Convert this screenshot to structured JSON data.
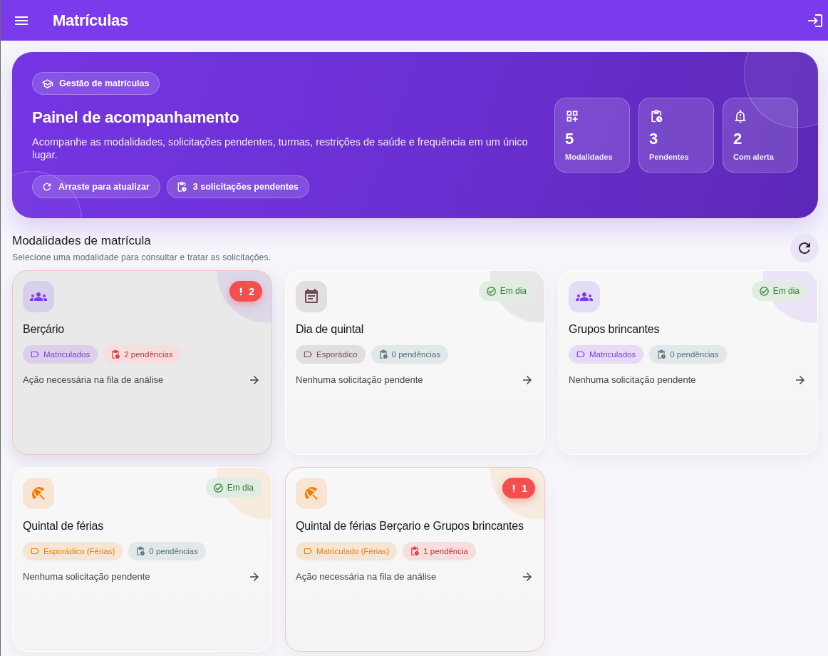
{
  "app_bar": {
    "title": "Matrículas"
  },
  "hero": {
    "badge": "Gestão de matrículas",
    "title": "Painel de acompanhamento",
    "description": "Acompanhe as modalidades, solicitações pendentes, turmas, restrições de saúde e frequência em um único lugar.",
    "chips": [
      {
        "kind": "refresh",
        "label": "Arraste para atualizar"
      },
      {
        "kind": "pending",
        "label": "3 solicitações pendentes"
      }
    ],
    "stats": [
      {
        "kind": "modalities",
        "value": "5",
        "label": "Modalidades"
      },
      {
        "kind": "pending",
        "value": "3",
        "label": "Pendentes"
      },
      {
        "kind": "alert",
        "value": "2",
        "label": "Com alerta"
      }
    ]
  },
  "section": {
    "title": "Modalidades de matrícula",
    "subtitle": "Selecione uma modalidade para consultar e tratar as solicitações."
  },
  "cards": [
    {
      "kind": "group",
      "color": "#7c3aed",
      "selected": true,
      "alert": true,
      "badge": "2",
      "title": "Berçário",
      "tag": "Matriculados",
      "pending": "2 pendências",
      "note": "Ação necessária na fila de análise"
    },
    {
      "kind": "calendar",
      "color": "#6d4c5a",
      "selected": false,
      "alert": false,
      "badge": "Em dia",
      "title": "Dia de quintal",
      "tag": "Esporádico",
      "pending": "0 pendências",
      "note": "Nenhuma solicitação pendente"
    },
    {
      "kind": "group",
      "color": "#7c3aed",
      "selected": false,
      "alert": false,
      "badge": "Em dia",
      "title": "Grupos brincantes",
      "tag": "Matriculados",
      "pending": "0 pendências",
      "note": "Nenhuma solicitação pendente"
    },
    {
      "kind": "holiday",
      "color": "#f57c00",
      "selected": false,
      "alert": false,
      "badge": "Em dia",
      "title": "Quintal de férias",
      "tag": "Esporádico (Férias)",
      "pending": "0 pendências",
      "note": "Nenhuma solicitação pendente"
    },
    {
      "kind": "holiday",
      "color": "#f57c00",
      "selected": false,
      "alert": true,
      "badge": "1",
      "title": "Quintal de férias Berçario e Grupos brincantes",
      "tag": "Matriculado (Férias)",
      "pending": "1 pendência",
      "note": "Ação necessária na fila de análise"
    }
  ]
}
